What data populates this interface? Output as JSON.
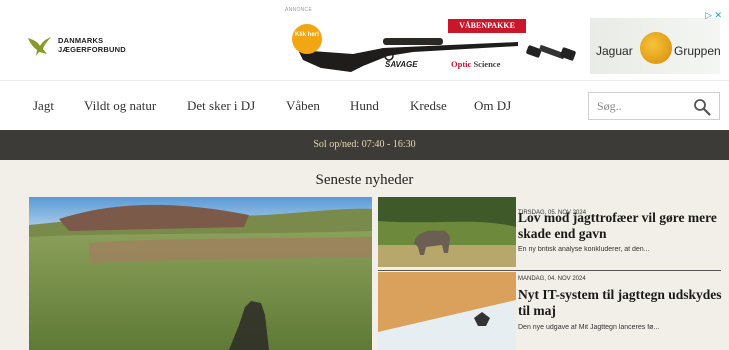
{
  "logo": {
    "line1": "DANMARKS",
    "line2": "JÆGERFORBUND"
  },
  "ad": {
    "label": "ANNONCE",
    "badge": "Klik her!",
    "banner": "VÅBENPAKKE",
    "brand_savage": "SAVAGE",
    "brand_optic_1": "Optic",
    "brand_optic_2": "Science",
    "jaguar_left": "Jaguar",
    "jaguar_right": "Gruppen",
    "close": "▷ ✕"
  },
  "nav": {
    "items": [
      "Jagt",
      "Vildt og natur",
      "Det sker i DJ",
      "Våben",
      "Hund",
      "Kredse",
      "Om DJ"
    ],
    "search_placeholder": "Søg.."
  },
  "sunbar": {
    "text": "Sol op/ned: 07:40 - 16:30"
  },
  "news": {
    "heading": "Seneste nyheder",
    "articles": [
      {
        "date": "TIRSDAG, 05. NOV 2024",
        "title": "Lov mod jagttrofæer vil gøre mere skade end gavn",
        "excerpt": "En ny britisk analyse konkluderer, at den..."
      },
      {
        "date": "MANDAG, 04. NOV 2024",
        "title": "Nyt IT-system til jagttegn udskydes til maj",
        "excerpt": "Den nye udgave af Mit Jagttegn lanceres fø..."
      }
    ]
  },
  "colors": {
    "accent_red": "#c9162b",
    "sunbar_bg": "#3d3b38",
    "sunbar_text": "#e8d9b0",
    "page_bg": "#f2efe8"
  }
}
